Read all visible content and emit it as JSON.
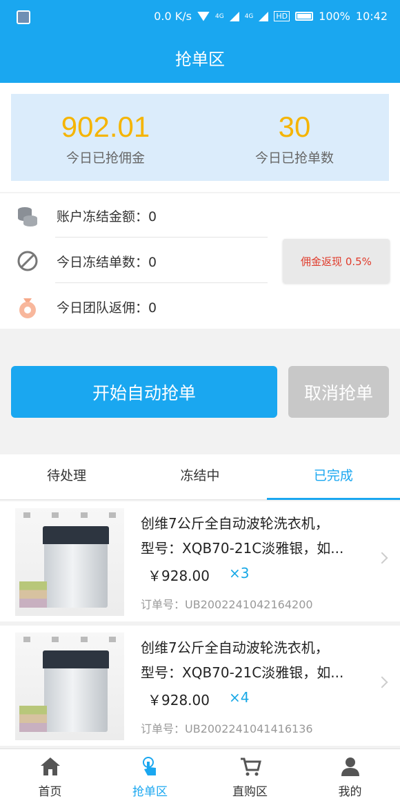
{
  "statusbar": {
    "network_speed": "0.0 K/s",
    "net_4g_1": "4G",
    "net_4g_2": "4G",
    "hd": "HD",
    "battery": "100%",
    "time": "10:42"
  },
  "header": {
    "title": "抢单区"
  },
  "stats": [
    {
      "value": "902.01",
      "label": "今日已抢佣金"
    },
    {
      "value": "30",
      "label": "今日已抢单数"
    }
  ],
  "info": {
    "frozen_amount": "账户冻结金额：0",
    "frozen_orders": "今日冻结单数：0",
    "team_rebate": "今日团队返佣：0",
    "cashback": "佣金返现 0.5%"
  },
  "buttons": {
    "start": "开始自动抢单",
    "cancel": "取消抢单"
  },
  "tabs": [
    "待处理",
    "冻结中",
    "已完成"
  ],
  "active_tab": "已完成",
  "orders": [
    {
      "name_line1": "创维7公斤全自动波轮洗衣机，",
      "name_line2": "型号：XQB70-21C淡雅银，如...",
      "price": "￥928.00",
      "qty": "×3",
      "order_no": "订单号：UB2002241042164200"
    },
    {
      "name_line1": "创维7公斤全自动波轮洗衣机，",
      "name_line2": "型号：XQB70-21C淡雅银，如...",
      "price": "￥928.00",
      "qty": "×4",
      "order_no": "订单号：UB2002241041416136"
    }
  ],
  "nav": [
    {
      "label": "首页",
      "icon": "home-icon"
    },
    {
      "label": "抢单区",
      "icon": "tap-hand-icon"
    },
    {
      "label": "直购区",
      "icon": "cart-icon"
    },
    {
      "label": "我的",
      "icon": "user-icon"
    }
  ],
  "colors": {
    "accent": "#1aa7f0",
    "stat_number": "#f5b400",
    "cashback_text": "#e03a2a"
  }
}
